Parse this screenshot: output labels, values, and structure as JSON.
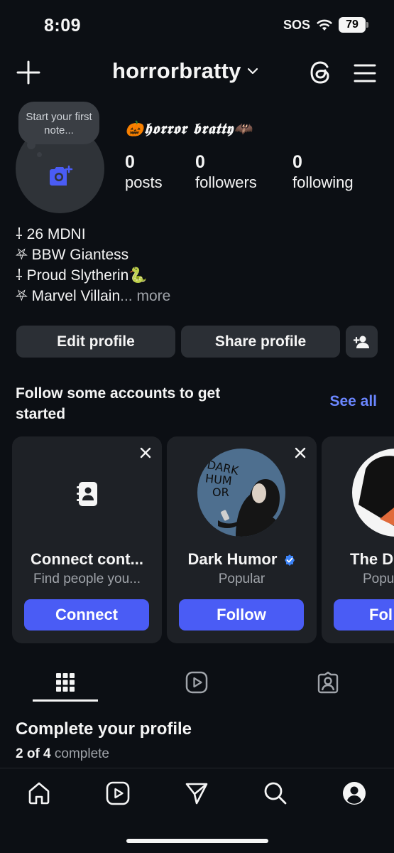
{
  "status_bar": {
    "time": "8:09",
    "sos": "SOS",
    "battery": "79"
  },
  "header": {
    "username": "horrorbratty"
  },
  "profile": {
    "note": "Start your first note...",
    "display_name": "🎃𝖍𝖔𝖗𝖗𝖔𝖗 𝖇𝖗𝖆𝖙𝖙𝖞🦇",
    "stats": [
      {
        "count": "0",
        "label": "posts"
      },
      {
        "count": "0",
        "label": "followers"
      },
      {
        "count": "0",
        "label": "following"
      }
    ],
    "bio": [
      "⸸ 26 MDNI",
      "⛧ BBW Giantess",
      "⸸ Proud Slytherin🐍",
      "⛧ Marvel Villain"
    ],
    "bio_more": "... more"
  },
  "actions": {
    "edit": "Edit profile",
    "share": "Share profile"
  },
  "suggestions": {
    "title": "Follow some accounts to get started",
    "see_all": "See all",
    "cards": [
      {
        "title": "Connect cont...",
        "subtitle": "Find people you...",
        "button": "Connect"
      },
      {
        "title": "Dark Humor",
        "subtitle": "Popular",
        "button": "Follow",
        "verified": true,
        "avatar_text": "DARK HUM OR"
      },
      {
        "title": "The D",
        "subtitle": "Popu",
        "button": "Fol"
      }
    ]
  },
  "complete": {
    "title": "Complete your profile",
    "count": "2 of 4",
    "suffix": "complete"
  },
  "colors": {
    "background": "#0c0f14",
    "accent": "#4a5cf5",
    "link": "#6b86ff",
    "verified": "#3b82f6"
  }
}
